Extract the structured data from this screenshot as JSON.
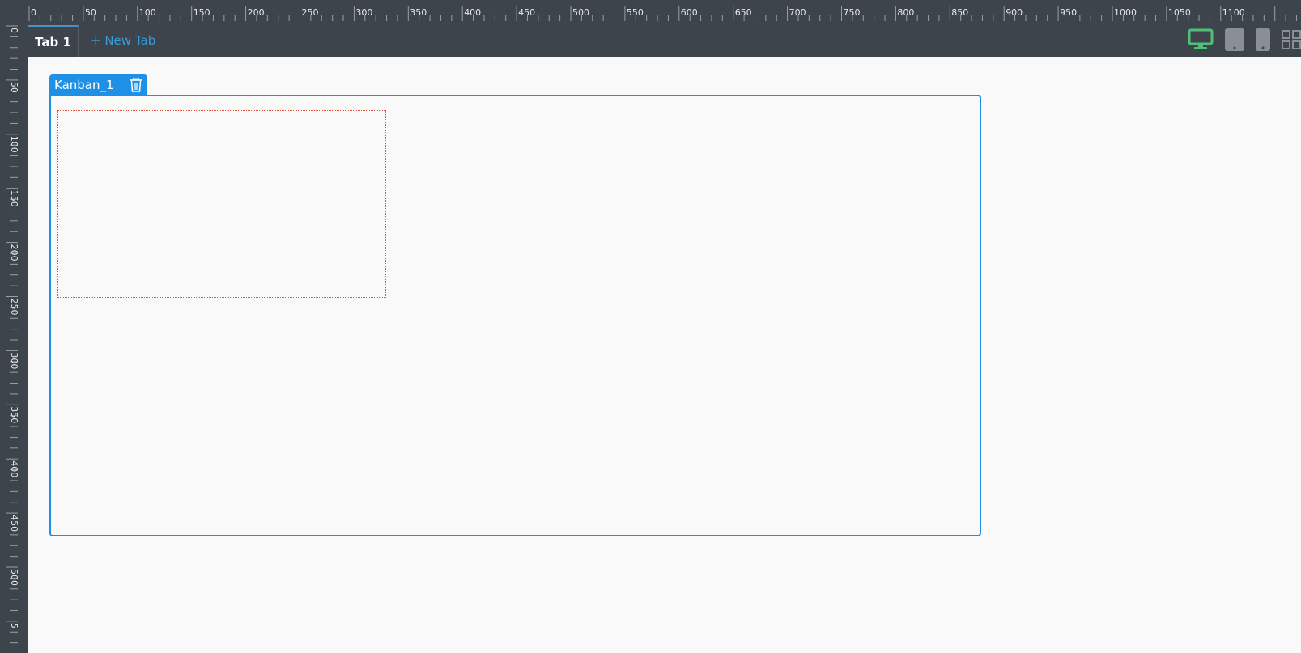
{
  "tabs": [
    {
      "label": "Tab 1",
      "active": true
    }
  ],
  "new_tab_label": "+ New Tab",
  "widget": {
    "name": "Kanban_1"
  },
  "ruler": {
    "top_labels": [
      "0",
      "50",
      "100",
      "150",
      "200",
      "250",
      "300",
      "350",
      "400",
      "450",
      "500",
      "550",
      "600",
      "650",
      "700",
      "750",
      "800",
      "850",
      "900",
      "950",
      "1000",
      "1050",
      "1100"
    ],
    "left_labels": [
      "0",
      "50",
      "100",
      "150",
      "200",
      "250",
      "300",
      "350",
      "400",
      "450",
      "500",
      "5"
    ]
  },
  "icons": {
    "desktop": "desktop-icon",
    "tablet": "tablet-icon",
    "phone": "phone-icon",
    "grid": "grid-icon",
    "delete": "trash-icon"
  },
  "colors": {
    "chrome_bg": "#3e444c",
    "canvas_bg": "#f9f9f9",
    "accent_blue": "#1e90e6",
    "link_blue": "#3a9ad9",
    "active_device": "#4fc07a",
    "inactive_device": "#8a8f95",
    "drop_outline": "#e0563b"
  }
}
